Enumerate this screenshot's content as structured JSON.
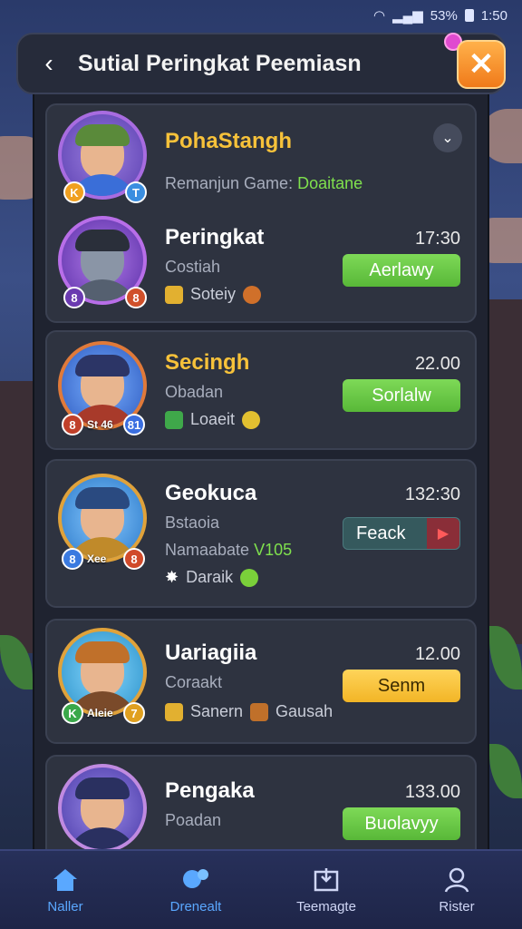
{
  "status_bar": {
    "signal": "📶",
    "battery_pct": "53%",
    "time": "1:50"
  },
  "header": {
    "title": "Sutial Peringkat Peemiasn",
    "back_icon": "chevron-left-icon",
    "close_icon": "close-icon"
  },
  "cards": [
    {
      "name": "PohaStangh",
      "line1_label": "Remanjun Game:",
      "line1_value": "Doaitane",
      "badges": [
        "K",
        "T"
      ]
    },
    {
      "name": "Peringkat",
      "time": "17:30",
      "subtitle": "Costiah",
      "item1": "Soteiy",
      "button": "Aerlawy",
      "badges": [
        "8",
        "8"
      ]
    },
    {
      "name": "Secingh",
      "time": "22.00",
      "subtitle": "Obadan",
      "item1": "Loaeit",
      "button": "Sorlalw",
      "badges": [
        "8",
        "81"
      ],
      "badge_text": "St 46"
    },
    {
      "name": "Geokuca",
      "time": "132:30",
      "subtitle": "Bstaoia",
      "line2_label": "Namaabate",
      "line2_value": "V105",
      "item1": "Daraik",
      "button": "Feack",
      "badge_text": "Xee"
    },
    {
      "name": "Uariagiia",
      "time": "12.00",
      "subtitle": "Coraakt",
      "item1": "Sanern",
      "item2": "Gausah",
      "button": "Senm",
      "badge_text": "Aleie",
      "badge_num": "7"
    },
    {
      "name": "Pengaka",
      "time": "133.00",
      "subtitle": "Poadan",
      "button": "Buolavyy"
    }
  ],
  "bottom_nav": [
    {
      "label": "Naller",
      "icon": "home-icon"
    },
    {
      "label": "Drenealt",
      "icon": "chat-icon"
    },
    {
      "label": "Teemagte",
      "icon": "trophy-icon"
    },
    {
      "label": "Rister",
      "icon": "profile-icon"
    }
  ],
  "colors": {
    "accent_green": "#7ed957",
    "accent_yellow": "#f2b526",
    "gold": "#f7c23a",
    "close_orange": "#f07a1a"
  }
}
